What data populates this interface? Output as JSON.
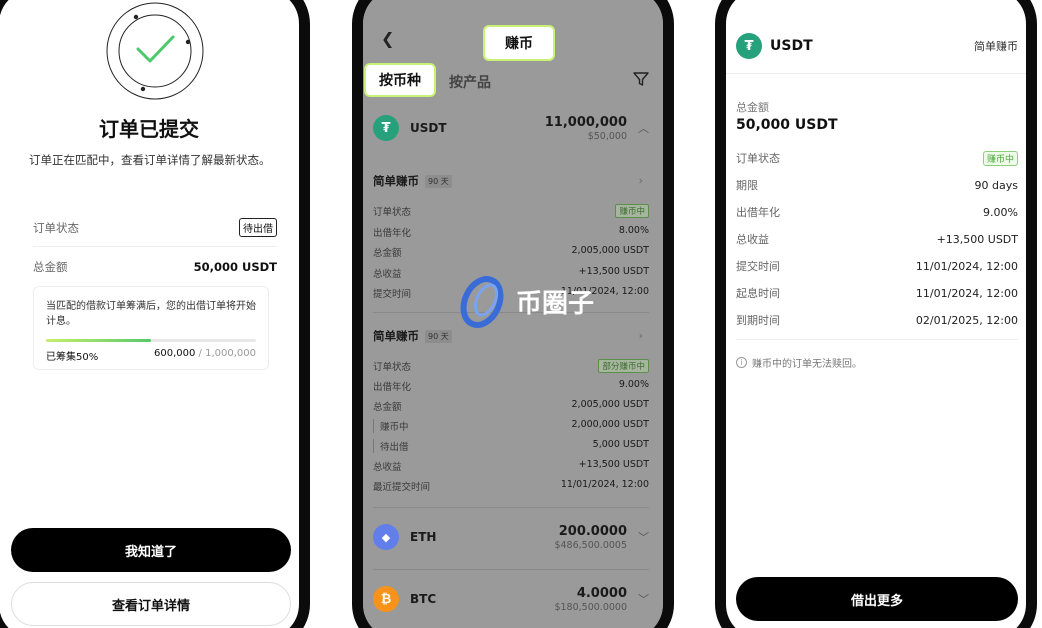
{
  "colors": {
    "accent_green": "#c9f275",
    "usdt_green": "#26a17b",
    "eth_blue": "#627eea",
    "btc_orange": "#f7931a"
  },
  "phone1": {
    "title": "订单已提交",
    "subtitle": "订单正在匹配中，查看订单详情了解最新状态。",
    "order_status_label": "订单状态",
    "order_status_badge": "待出借",
    "total_label": "总金额",
    "total_value": "50,000 USDT",
    "info_text": "当匹配的借款订单筹满后，您的出借订单将开始计息。",
    "progress_label": "已筹集50%",
    "progress_fraction": 0.5,
    "progress_current": "600,000",
    "progress_total": " / 1,000,000",
    "primary_button": "我知道了",
    "secondary_button": "查看订单详情"
  },
  "phone2": {
    "header_title": "赚币",
    "tab_active": "按币种",
    "tab_inactive": "按产品",
    "coins": [
      {
        "icon": "usdt-icon",
        "symbol": "₮",
        "name": "USDT",
        "amount": "11,000,000",
        "usd": "$50,000"
      },
      {
        "icon": "eth-icon",
        "symbol": "◆",
        "name": "ETH",
        "amount": "200.0000",
        "usd": "$486,500.0005"
      },
      {
        "icon": "btc-icon",
        "symbol": "₿",
        "name": "BTC",
        "amount": "4.0000",
        "usd": "$180,500.0000"
      }
    ],
    "section1": {
      "title": "简单赚币",
      "days": "90 天",
      "rows": [
        {
          "label": "订单状态",
          "value": "赚币中",
          "tag": true
        },
        {
          "label": "出借年化",
          "value": "8.00%"
        },
        {
          "label": "总金额",
          "value": "2,005,000 USDT"
        },
        {
          "label": "总收益",
          "value": "+13,500 USDT"
        },
        {
          "label": "提交时间",
          "value": "11/01/2024, 12:00"
        }
      ]
    },
    "section2": {
      "title": "简单赚币",
      "days": "90 天",
      "rows": [
        {
          "label": "订单状态",
          "value": "部分赚币中",
          "tag": true
        },
        {
          "label": "出借年化",
          "value": "9.00%"
        },
        {
          "label": "总金额",
          "value": "2,005,000 USDT"
        },
        {
          "label": "赚币中",
          "value": "2,000,000 USDT",
          "indent": true
        },
        {
          "label": "待出借",
          "value": "5,000 USDT",
          "indent": true
        },
        {
          "label": "总收益",
          "value": "+13,500 USDT"
        },
        {
          "label": "最近提交时间",
          "value": "11/01/2024, 12:00"
        }
      ]
    },
    "watermark_text": "币圈子"
  },
  "phone3": {
    "coin": "USDT",
    "product": "简单赚币",
    "total_label": "总金额",
    "total_value": "50,000 USDT",
    "rows": [
      {
        "label": "订单状态",
        "value": "赚币中",
        "tag": true
      },
      {
        "label": "期限",
        "value": "90 days"
      },
      {
        "label": "出借年化",
        "value": "9.00%"
      },
      {
        "label": "总收益",
        "value": "+13,500 USDT"
      },
      {
        "label": "提交时间",
        "value": "11/01/2024, 12:00"
      },
      {
        "label": "起息时间",
        "value": "11/01/2024, 12:00"
      },
      {
        "label": "到期时间",
        "value": "02/01/2025, 12:00"
      }
    ],
    "note": "赚币中的订单无法赎回。",
    "button": "借出更多"
  }
}
